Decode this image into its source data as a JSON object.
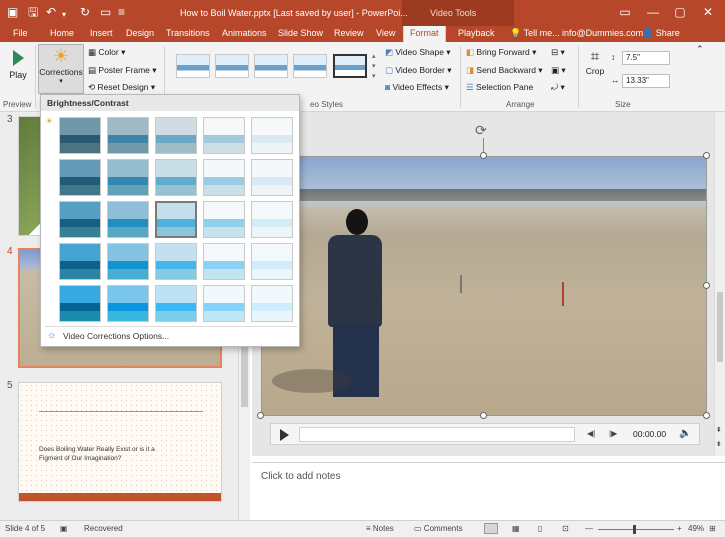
{
  "titlebar": {
    "title": "How to Boil Water.pptx [Last saved by user] - PowerPoi...",
    "video_tools": "Video Tools",
    "controls": [
      "▭",
      "—",
      "▢",
      "✕"
    ]
  },
  "tabs": [
    "File",
    "Home",
    "Insert",
    "Design",
    "Transitions",
    "Animations",
    "Slide Show",
    "Review",
    "View",
    "Format",
    "Playback"
  ],
  "active_tab": "Format",
  "tell_me": "Tell me...",
  "account": "info@Dummies.com",
  "share": "Share",
  "ribbon": {
    "play_label": "Play",
    "corrections_label": "Corrections",
    "color_label": "Color ▾",
    "poster_frame_label": "Poster Frame ▾",
    "reset_design_label": "Reset Design ▾",
    "video_shape_label": "Video Shape ▾",
    "video_border_label": "Video Border ▾",
    "video_effects_label": "Video Effects ▾",
    "bring_forward_label": "Bring Forward ▾",
    "send_backward_label": "Send Backward ▾",
    "selection_pane_label": "Selection Pane",
    "crop_label": "Crop",
    "height_value": "7.5\"",
    "width_value": "13.33\"",
    "groups": {
      "preview": "Preview",
      "video_styles": "eo Styles",
      "arrange": "Arrange",
      "size": "Size"
    }
  },
  "corrections_menu": {
    "header": "Brightness/Contrast",
    "option": "Video Corrections Options...",
    "rows": 5,
    "cols": 5,
    "selected": {
      "row": 2,
      "col": 2
    }
  },
  "slides": [
    {
      "number": "3"
    },
    {
      "number": "4"
    },
    {
      "number": "5",
      "text": "Does Boiling Water Really Exist or is it a Figment of Our Imagination?"
    }
  ],
  "player": {
    "time": "00:00.00"
  },
  "notes": {
    "placeholder": "Click to add notes"
  },
  "status": {
    "slide": "Slide 4 of 5",
    "recovered": "Recovered",
    "notes": "Notes",
    "comments": "Comments",
    "zoom": "49%"
  },
  "colors": {
    "accent": "#b7472a",
    "tab_active_text": "#b7472a"
  }
}
